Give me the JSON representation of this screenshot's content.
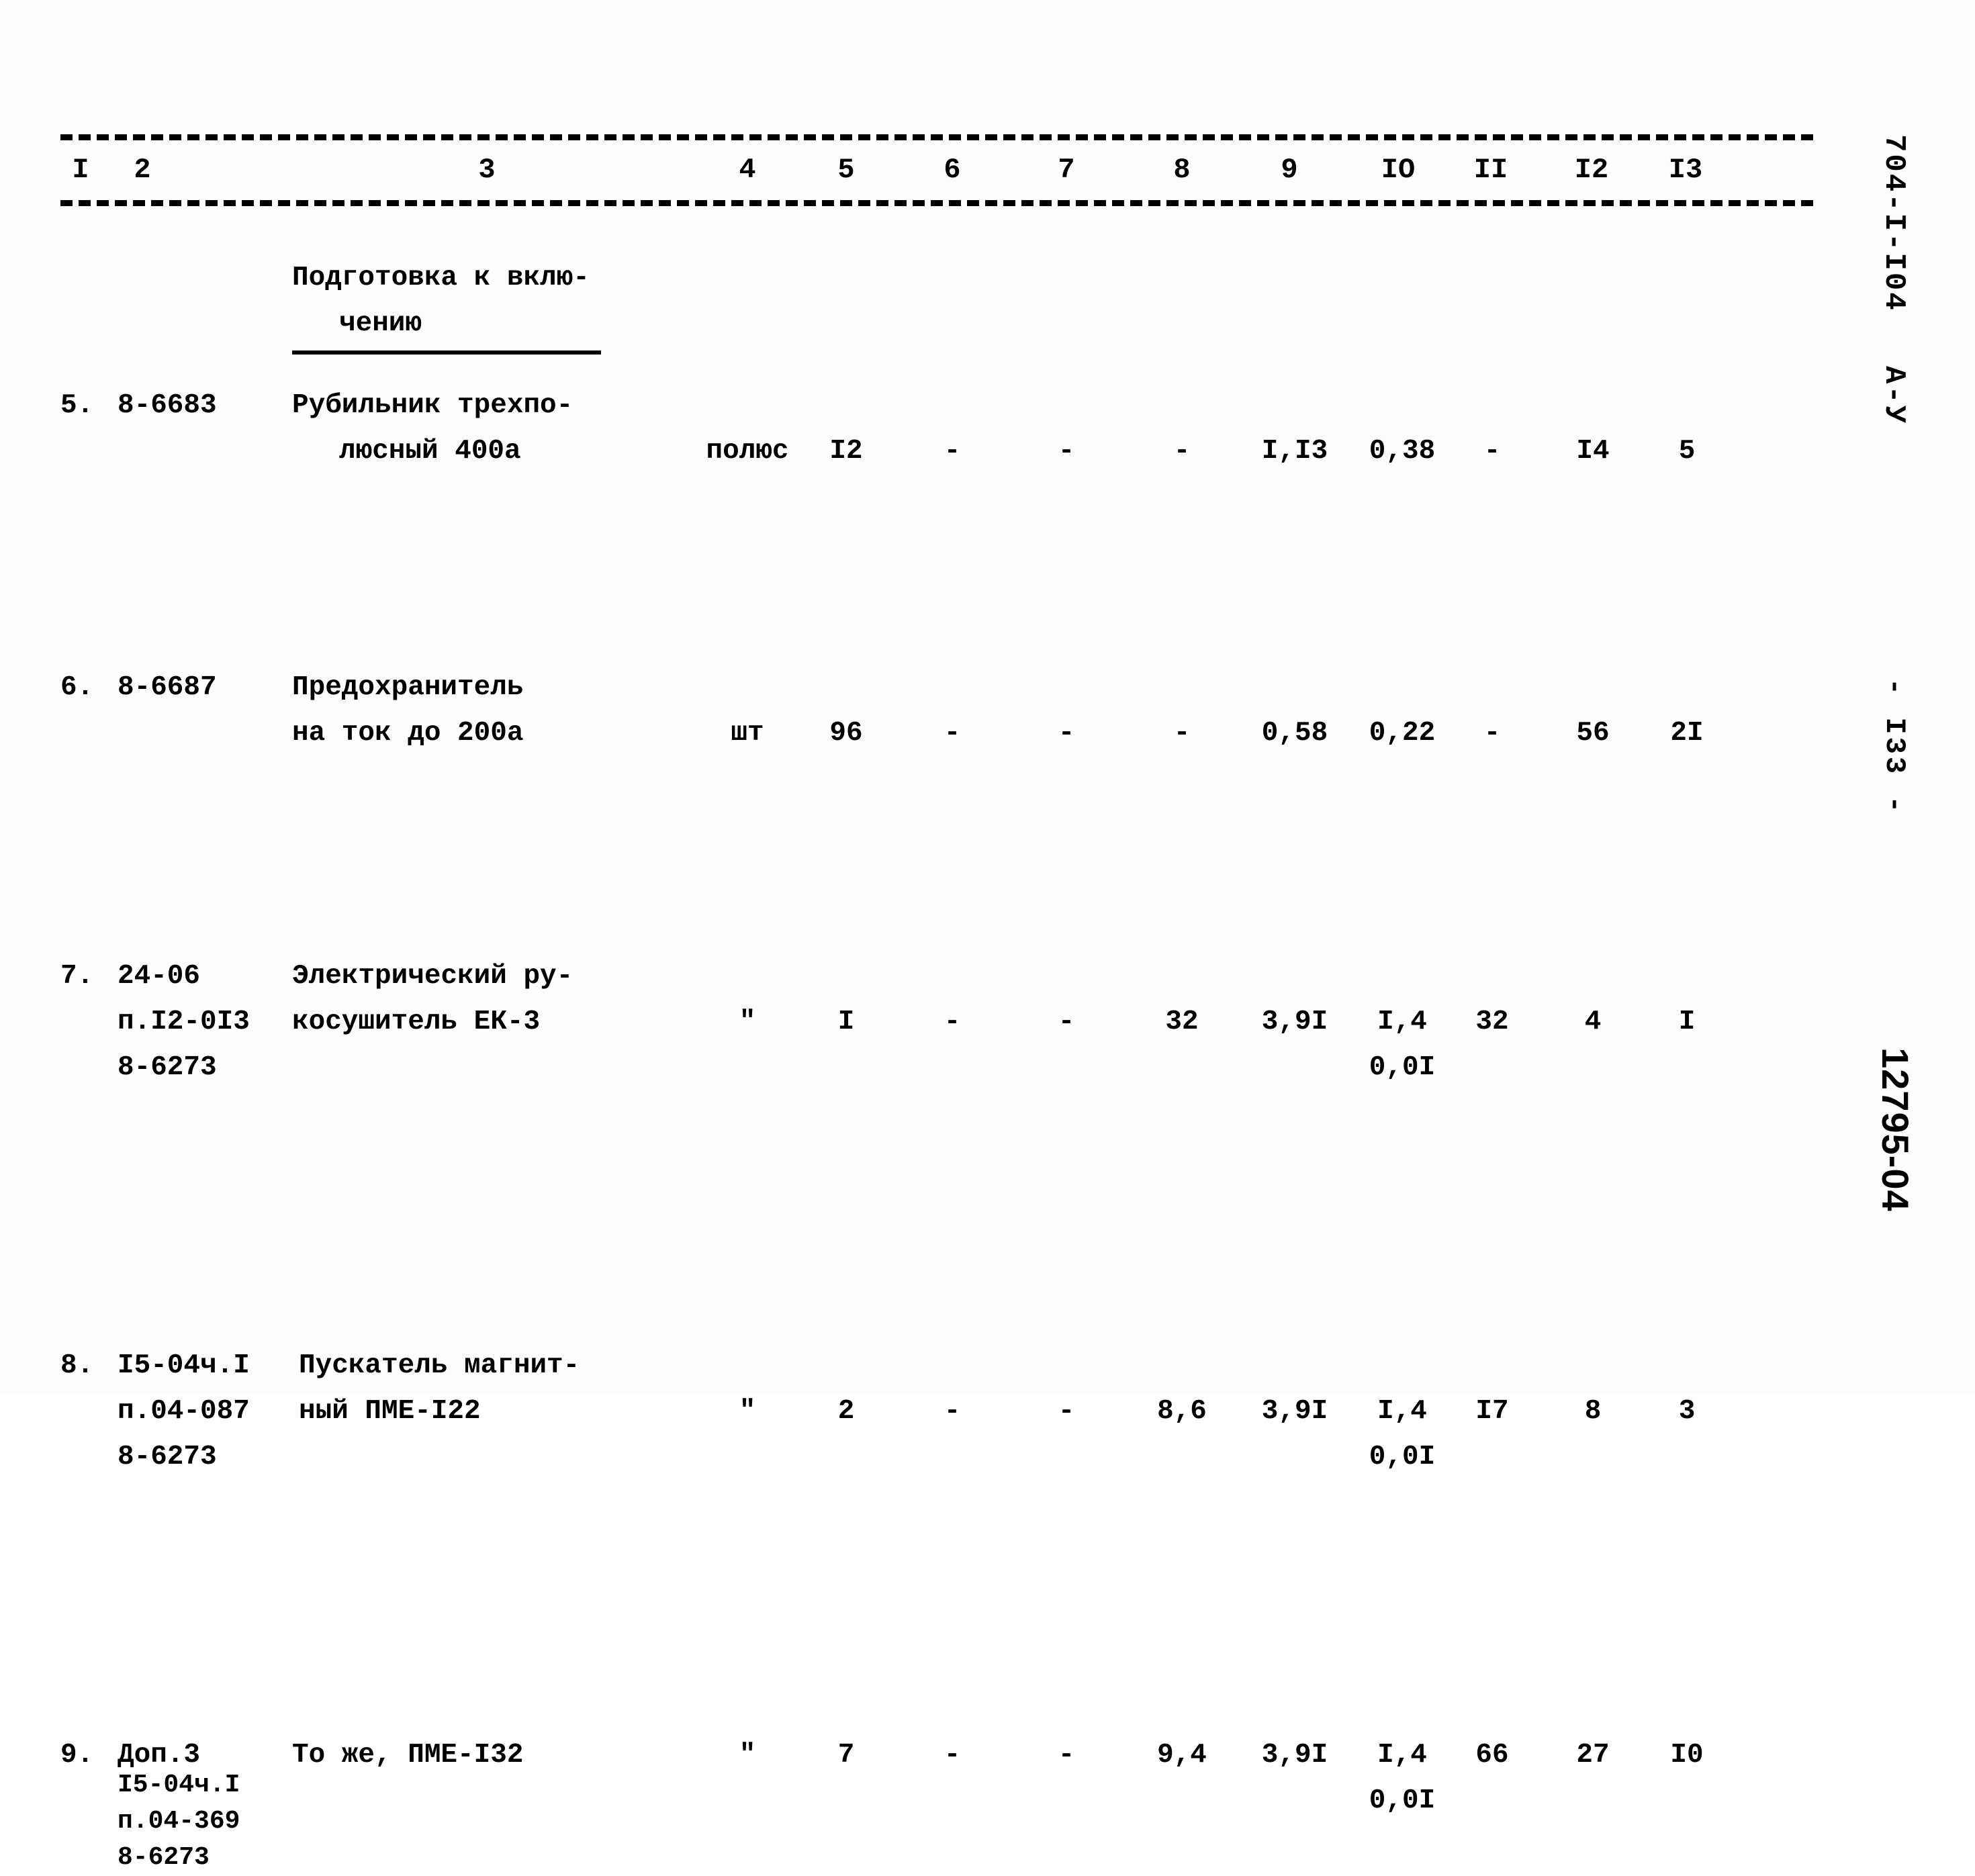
{
  "document": {
    "doc_code": "704-I-I04",
    "doc_subcode": "А-У",
    "page_marker": "- I33 -",
    "handwritten_number": "12795-04"
  },
  "table": {
    "column_numbers": [
      "I",
      "2",
      "3",
      "4",
      "5",
      "6",
      "7",
      "8",
      "9",
      "IO",
      "II",
      "I2",
      "I3"
    ],
    "group_heading": {
      "line1": "Подготовка к вклю-",
      "line2": "чению"
    },
    "rows": [
      {
        "num": "5.",
        "code_lines": [
          "8-6683"
        ],
        "name_lines": [
          "Рубильник трехпо-",
          "люсный 400а"
        ],
        "c4": "полюс",
        "c5": "I2",
        "c6": "-",
        "c7": "-",
        "c8": "-",
        "c9": "I,I3",
        "c10_a": "0,38",
        "c10_b": "",
        "c11": "-",
        "c12": "I4",
        "c13": "5"
      },
      {
        "num": "6.",
        "code_lines": [
          "8-6687"
        ],
        "name_lines": [
          "Предохранитель",
          "на ток до 200а"
        ],
        "c4": "шт",
        "c5": "96",
        "c6": "-",
        "c7": "-",
        "c8": "-",
        "c9": "0,58",
        "c10_a": "0,22",
        "c10_b": "",
        "c11": "-",
        "c12": "56",
        "c13": "2I"
      },
      {
        "num": "7.",
        "code_lines": [
          "24-06",
          "п.I2-0I3",
          "8-6273"
        ],
        "name_lines": [
          "Электрический ру-",
          "косушитель ЕК-3"
        ],
        "c4": "\"",
        "c5": "I",
        "c6": "-",
        "c7": "-",
        "c8": "32",
        "c9": "3,9I",
        "c10_a": "I,4",
        "c10_b": "0,0I",
        "c11": "32",
        "c12": "4",
        "c13": "I"
      },
      {
        "num": "8.",
        "code_lines": [
          "I5-04ч.I",
          "п.04-087",
          "8-6273"
        ],
        "name_lines": [
          "Пускатель магнит-",
          "ный ПМЕ-I22"
        ],
        "c4": "\"",
        "c5": "2",
        "c6": "-",
        "c7": "-",
        "c8": "8,6",
        "c9": "3,9I",
        "c10_a": "I,4",
        "c10_b": "0,0I",
        "c11": "I7",
        "c12": "8",
        "c13": "3"
      },
      {
        "num": "9.",
        "code_lines": [
          "Доп.3",
          "I5-04ч.I",
          "п.04-369",
          "8-6273"
        ],
        "name_lines": [
          "То же, ПМЕ-I32"
        ],
        "c4": "\"",
        "c5": "7",
        "c6": "-",
        "c7": "-",
        "c8": "9,4",
        "c9": "3,9I",
        "c10_a": "I,4",
        "c10_b": "0,0I",
        "c11": "66",
        "c12": "27",
        "c13": "I0"
      }
    ]
  }
}
